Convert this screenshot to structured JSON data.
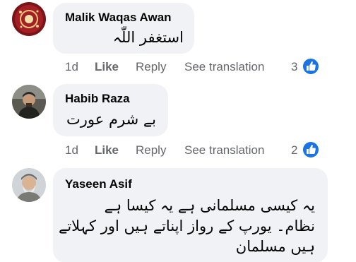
{
  "comments": [
    {
      "author": "Malik Waqas Awan",
      "text": "استغفر اللّٰہ",
      "time": "1d",
      "like": "Like",
      "reply": "Reply",
      "translate": "See translation",
      "reactions": "3",
      "reaction_icon": "like-icon"
    },
    {
      "author": "Habib Raza",
      "text": "بے شرم عورت",
      "time": "1d",
      "like": "Like",
      "reply": "Reply",
      "translate": "See translation",
      "reactions": "2",
      "reaction_icon": "like-icon"
    },
    {
      "author": "Yaseen Asif",
      "lines": [
        "یہ کیسی مسلمانی ہے یہ کیسا ہے",
        "نظام۔ یورپ کے رواز اپناتے ہیں اور کہلاتے",
        "ہیں مسلمان"
      ]
    }
  ],
  "colors": {
    "bubble": "#f0f2f5",
    "meta_text": "#65676b",
    "like_blue": "#1b74e4"
  }
}
